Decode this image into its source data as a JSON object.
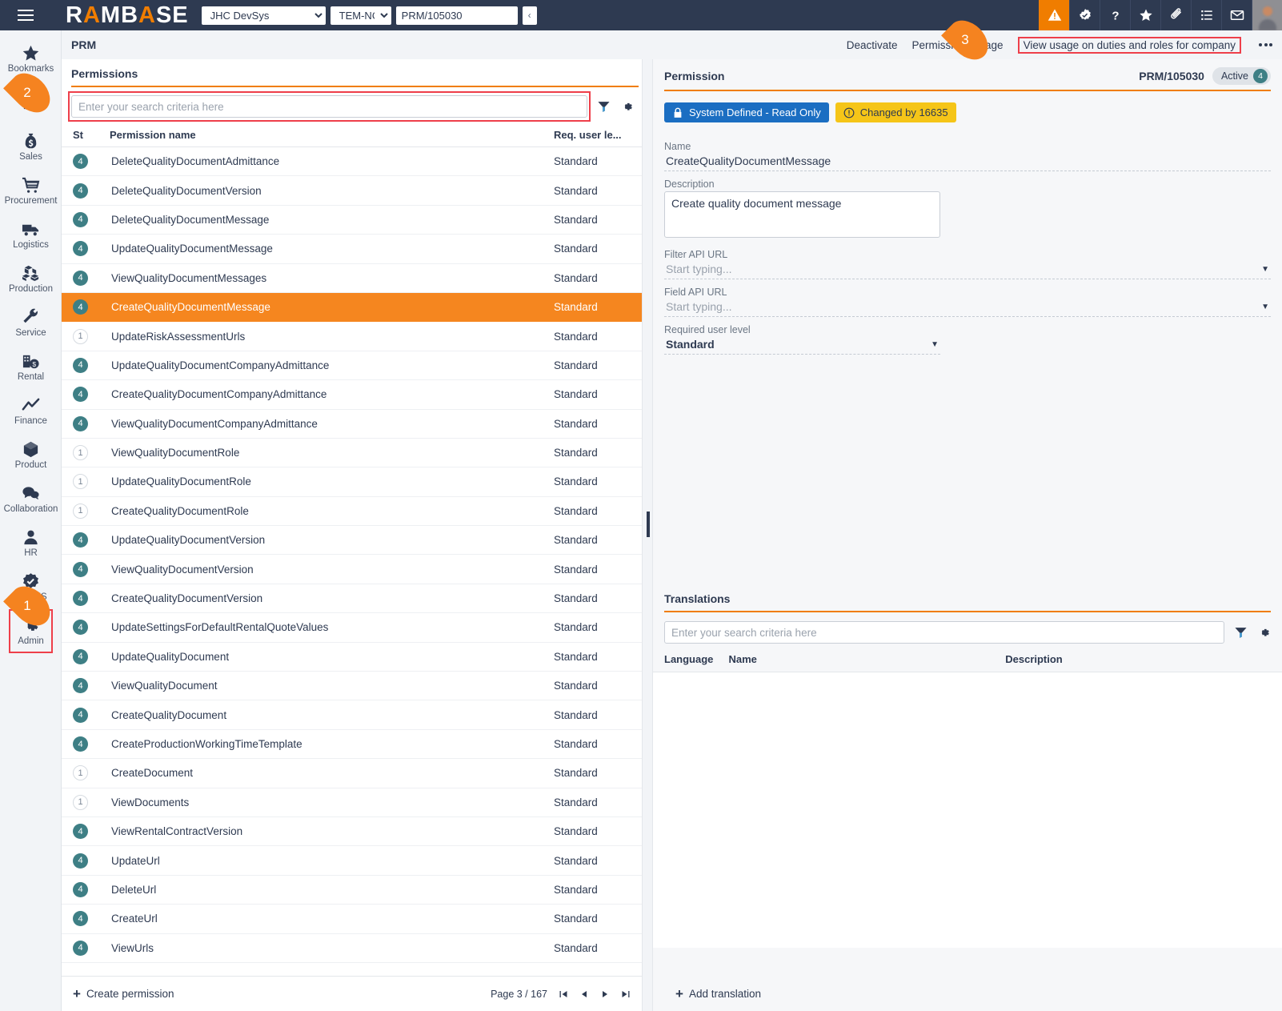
{
  "header": {
    "brand_left": "RAMB",
    "brand_accent1": "A",
    "brand_mid": "",
    "brand_right": "SE",
    "brand_full": "RAMBASE",
    "company": "JHC DevSys",
    "system": "TEM-NO",
    "document_id": "PRM/105030",
    "collapse_glyph": "‹",
    "icons": [
      {
        "name": "warning-icon",
        "label": "Warnings",
        "active": true
      },
      {
        "name": "approval-badge-icon",
        "label": "Approvals",
        "active": false
      },
      {
        "name": "help-icon",
        "label": "Help",
        "active": false
      },
      {
        "name": "favourites-star-icon",
        "label": "Favourites",
        "active": false
      },
      {
        "name": "attachment-icon",
        "label": "Attachments",
        "active": false
      },
      {
        "name": "tasklist-icon",
        "label": "Tasks",
        "active": false
      },
      {
        "name": "messages-icon",
        "label": "Messages",
        "active": false
      }
    ]
  },
  "sidebar": {
    "items": [
      {
        "label": "Bookmarks",
        "icon": "star-icon"
      },
      {
        "label": "",
        "icon": "dashboard-icon"
      },
      {
        "label": "Sales",
        "icon": "money-bag-icon"
      },
      {
        "label": "Procurement",
        "icon": "shopping-cart-icon"
      },
      {
        "label": "Logistics",
        "icon": "truck-icon"
      },
      {
        "label": "Production",
        "icon": "boxes-icon"
      },
      {
        "label": "Service",
        "icon": "wrench-icon"
      },
      {
        "label": "Rental",
        "icon": "rental-icon"
      },
      {
        "label": "Finance",
        "icon": "chart-line-icon"
      },
      {
        "label": "Product",
        "icon": "cube-icon"
      },
      {
        "label": "Collaboration",
        "icon": "chat-bubbles-icon"
      },
      {
        "label": "HR",
        "icon": "person-icon"
      },
      {
        "label": "QHSES",
        "icon": "check-badge-icon"
      },
      {
        "label": "Admin",
        "icon": "gear-icon"
      }
    ],
    "active_label": "Admin"
  },
  "actionbar": {
    "breadcrumb": "PRM",
    "links": [
      {
        "label": "Deactivate",
        "highlight": false
      },
      {
        "label": "Permissions usage",
        "highlight": false
      },
      {
        "label": "View usage on duties and roles for company",
        "highlight": true
      }
    ],
    "more_label": "More options"
  },
  "permissions_panel": {
    "title": "Permissions",
    "search_placeholder": "Enter your search criteria here",
    "search_value": "",
    "filter_icon": "filter-icon",
    "settings_icon": "gear-icon",
    "columns": [
      "St",
      "Permission name",
      "Req. user le..."
    ],
    "rows": [
      {
        "st": "4",
        "name": "DeleteQualityDocumentAdmittance",
        "level": "Standard",
        "selected": false
      },
      {
        "st": "4",
        "name": "DeleteQualityDocumentVersion",
        "level": "Standard",
        "selected": false
      },
      {
        "st": "4",
        "name": "DeleteQualityDocumentMessage",
        "level": "Standard",
        "selected": false
      },
      {
        "st": "4",
        "name": "UpdateQualityDocumentMessage",
        "level": "Standard",
        "selected": false
      },
      {
        "st": "4",
        "name": "ViewQualityDocumentMessages",
        "level": "Standard",
        "selected": false
      },
      {
        "st": "4",
        "name": "CreateQualityDocumentMessage",
        "level": "Standard",
        "selected": true
      },
      {
        "st": "1",
        "name": "UpdateRiskAssessmentUrls",
        "level": "Standard",
        "selected": false
      },
      {
        "st": "4",
        "name": "UpdateQualityDocumentCompanyAdmittance",
        "level": "Standard",
        "selected": false
      },
      {
        "st": "4",
        "name": "CreateQualityDocumentCompanyAdmittance",
        "level": "Standard",
        "selected": false
      },
      {
        "st": "4",
        "name": "ViewQualityDocumentCompanyAdmittance",
        "level": "Standard",
        "selected": false
      },
      {
        "st": "1",
        "name": "ViewQualityDocumentRole",
        "level": "Standard",
        "selected": false
      },
      {
        "st": "1",
        "name": "UpdateQualityDocumentRole",
        "level": "Standard",
        "selected": false
      },
      {
        "st": "1",
        "name": "CreateQualityDocumentRole",
        "level": "Standard",
        "selected": false
      },
      {
        "st": "4",
        "name": "UpdateQualityDocumentVersion",
        "level": "Standard",
        "selected": false
      },
      {
        "st": "4",
        "name": "ViewQualityDocumentVersion",
        "level": "Standard",
        "selected": false
      },
      {
        "st": "4",
        "name": "CreateQualityDocumentVersion",
        "level": "Standard",
        "selected": false
      },
      {
        "st": "4",
        "name": "UpdateSettingsForDefaultRentalQuoteValues",
        "level": "Standard",
        "selected": false
      },
      {
        "st": "4",
        "name": "UpdateQualityDocument",
        "level": "Standard",
        "selected": false
      },
      {
        "st": "4",
        "name": "ViewQualityDocument",
        "level": "Standard",
        "selected": false
      },
      {
        "st": "4",
        "name": "CreateQualityDocument",
        "level": "Standard",
        "selected": false
      },
      {
        "st": "4",
        "name": "CreateProductionWorkingTimeTemplate",
        "level": "Standard",
        "selected": false
      },
      {
        "st": "1",
        "name": "CreateDocument",
        "level": "Standard",
        "selected": false
      },
      {
        "st": "1",
        "name": "ViewDocuments",
        "level": "Standard",
        "selected": false
      },
      {
        "st": "4",
        "name": "ViewRentalContractVersion",
        "level": "Standard",
        "selected": false
      },
      {
        "st": "4",
        "name": "UpdateUrl",
        "level": "Standard",
        "selected": false
      },
      {
        "st": "4",
        "name": "DeleteUrl",
        "level": "Standard",
        "selected": false
      },
      {
        "st": "4",
        "name": "CreateUrl",
        "level": "Standard",
        "selected": false
      },
      {
        "st": "4",
        "name": "ViewUrls",
        "level": "Standard",
        "selected": false
      }
    ],
    "footer": {
      "create_label": "Create permission",
      "page_label": "Page 3 / 167",
      "first_icon": "first-page-icon",
      "prev_icon": "previous-page-icon",
      "next_icon": "next-page-icon",
      "last_icon": "last-page-icon"
    }
  },
  "permission_detail": {
    "title": "Permission",
    "id": "PRM/105030",
    "status_label": "Active",
    "status_count": "4",
    "tags": [
      {
        "label": "System Defined - Read Only",
        "style": "blue",
        "icon": "lock-icon"
      },
      {
        "label": "Changed by 16635",
        "style": "yellow",
        "icon": "info-icon"
      }
    ],
    "fields": {
      "name_label": "Name",
      "name_value": "CreateQualityDocumentMessage",
      "description_label": "Description",
      "description_value": "Create quality document message",
      "filter_api_label": "Filter API URL",
      "filter_api_placeholder": "Start typing...",
      "field_api_label": "Field API URL",
      "field_api_placeholder": "Start typing...",
      "user_level_label": "Required user level",
      "user_level_value": "Standard"
    }
  },
  "translations": {
    "title": "Translations",
    "search_placeholder": "Enter your search criteria here",
    "search_value": "",
    "columns": [
      "Language",
      "Name",
      "Description"
    ],
    "rows": [],
    "add_label": "Add translation"
  },
  "callouts": [
    {
      "number": "1",
      "target": "sidebar-item-admin"
    },
    {
      "number": "2",
      "target": "permissions-search-input"
    },
    {
      "number": "3",
      "target": "view-usage-link"
    }
  ],
  "colors": {
    "header_bg": "#2e3a51",
    "accent_orange": "#f07d00",
    "selection_orange": "#f5861f",
    "badge_teal": "#3e7f85",
    "callout_orange": "#f58320",
    "highlight_red": "#ee3f4a",
    "tag_blue": "#1b6ec2",
    "tag_yellow": "#f5c518"
  }
}
